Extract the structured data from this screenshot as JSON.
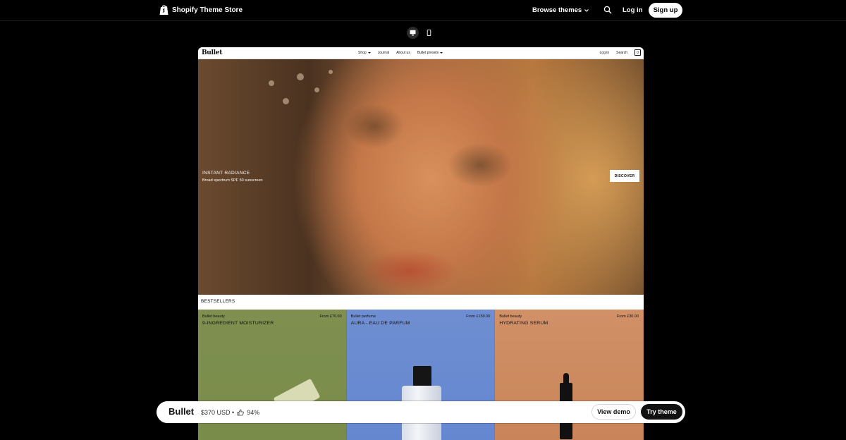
{
  "topbar": {
    "brand_text": "Shopify Theme Store",
    "browse_label": "Browse themes",
    "login_label": "Log in",
    "signup_label": "Sign up"
  },
  "preview": {
    "store_logo": "Bullet",
    "nav": {
      "shop": "Shop",
      "journal": "Journal",
      "about": "About us",
      "presets": "Bullet presets",
      "login": "Log in",
      "search": "Search",
      "cart_count": "0"
    },
    "hero": {
      "title": "INSTANT RADIANCE",
      "subtitle": "Broad spectrum SPF 50 sunscreen",
      "cta": "DISCOVER"
    },
    "bestsellers_heading": "BESTSELLERS",
    "products": [
      {
        "brand": "Bullet beauty",
        "name": "9-INGREDIENT MOISTURIZER",
        "price": "From £70.00"
      },
      {
        "brand": "Bullet perfume",
        "name": "AURA - EAU DE PARFUM",
        "price": "From £150.00"
      },
      {
        "brand": "Bullet beauty",
        "name": "HYDRATING SERUM",
        "price": "From £30.00"
      }
    ]
  },
  "bottombar": {
    "theme_name": "Bullet",
    "price": "$370 USD •",
    "rating": "94%",
    "view_demo": "View demo",
    "try_theme": "Try theme"
  },
  "colors": {
    "background": "#000000",
    "accent_button": "#111111",
    "card_green": "#7e8f4f",
    "card_blue": "#6f8ed1",
    "card_peach": "#d19067"
  }
}
